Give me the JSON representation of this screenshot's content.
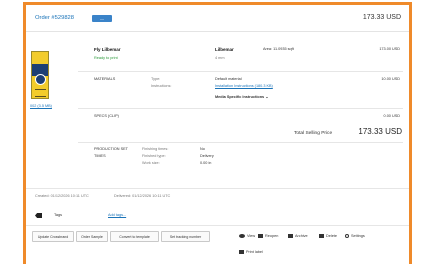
{
  "header": {
    "order_title": "Order #529828",
    "badge": "—",
    "price": "173.33 USD"
  },
  "item": {
    "thumb_file": "002 (3.5 MB)",
    "name": "Fly Lilbemar",
    "status": "Ready to print",
    "col_name": "Lilbemar",
    "col_size": "4 mm",
    "area": "Area: 11.0935 sqft",
    "price": "173.00 USD"
  },
  "materials": {
    "label": "MATERIALS",
    "type_label": "Type:",
    "instr_label": "Instructions:",
    "material_value": "Default material",
    "instructions_link": "Installation Instructions (180.3 KB)",
    "specific_toggle": "Media Specific Instructions ⌄",
    "price": "10.00 USD"
  },
  "discount": {
    "label": "SPECS (CLIP)",
    "value": "0.00 USD"
  },
  "total": {
    "label": "Total Selling Price",
    "value": "173.33 USD"
  },
  "production": {
    "label": "PRODUCTION SET",
    "sub_label": "TIMES",
    "rows": [
      {
        "key": "Finishing times:",
        "value": "No"
      },
      {
        "key": "Finished type:",
        "value": "Delivery"
      },
      {
        "key": "Work size:",
        "value": "0.00 in"
      }
    ]
  },
  "meta": {
    "created": "Created: 01/12/2026 10:11 UTC",
    "updated": "Delivered: 01/12/2026 10:11 UTC"
  },
  "tags": {
    "label": "Tags",
    "add_link": "Add tags..."
  },
  "buttons": [
    "Update Crossbrand",
    "Order Sample",
    "Convert to template",
    "Set tracking number"
  ],
  "actions": {
    "view": "View",
    "reopen": "Reopen",
    "archive": "Archive",
    "delete": "Delete",
    "settings": "Settings",
    "print": "Print label"
  },
  "colors": {
    "frame": "#ef8a2a",
    "accent": "#1a73b8",
    "status": "#2c9a3b"
  }
}
